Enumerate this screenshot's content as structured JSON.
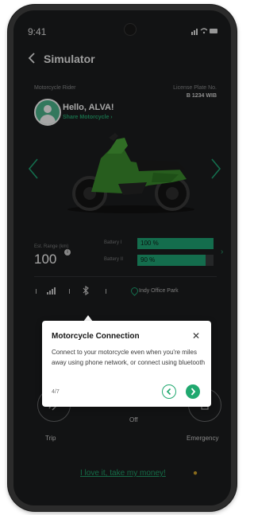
{
  "status_bar": {
    "time": "9:41",
    "icons": "signal wifi battery"
  },
  "header": {
    "back_icon": "chevron-left-icon",
    "title": "Simulator"
  },
  "rider": {
    "label": "Motorcycle Rider",
    "greeting": "Hello, ALVA!",
    "share": "Share Motorcycle"
  },
  "plate": {
    "label": "License Plate No.",
    "value": "B 1234 WIB"
  },
  "range": {
    "label": "Est. Range (km)",
    "value": "100"
  },
  "batteries": [
    {
      "label": "Battery I",
      "value": "100 %",
      "fraction": 1.0
    },
    {
      "label": "Battery II",
      "value": "90 %",
      "fraction": 0.9
    }
  ],
  "connection": {
    "location": "Indy Office Park",
    "icons": [
      "signal-icon",
      "bluetooth-icon",
      "location-pin-icon"
    ]
  },
  "actions": [
    {
      "label": "Trip",
      "icon": "trip-icon"
    },
    {
      "label": "Off",
      "icon": "power-icon"
    },
    {
      "label": "Emergency",
      "icon": "emergency-icon"
    }
  ],
  "cta": {
    "text": "I love it, take my money!",
    "icon": "money-bag-icon"
  },
  "tooltip": {
    "title": "Motorcycle Connection",
    "body": "Connect to your motorcycle even when you're miles away using phone network, or connect using bluetooth",
    "step": "4/7"
  },
  "colors": {
    "background": "#1d1e1f",
    "accent": "#1fa877",
    "cta": "#21a56d"
  }
}
